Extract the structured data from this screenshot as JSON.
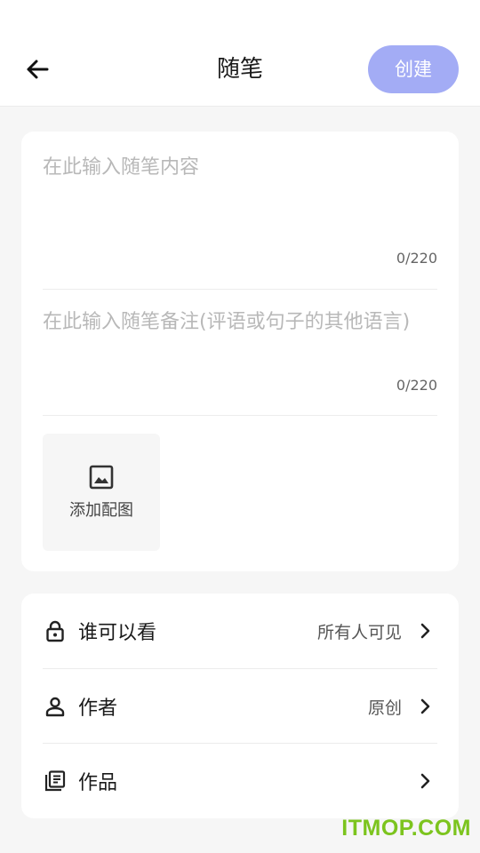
{
  "header": {
    "title": "随笔",
    "create_label": "创建",
    "back_icon": "arrow-left-icon",
    "accent_color": "#a3acf5"
  },
  "editor": {
    "content_placeholder": "在此输入随笔内容",
    "content_counter": "0/220",
    "remark_placeholder": "在此输入随笔备注(评语或句子的其他语言)",
    "remark_counter": "0/220",
    "add_image_label": "添加配图",
    "add_image_icon": "image-icon"
  },
  "settings": {
    "rows": [
      {
        "icon": "lock-icon",
        "label": "谁可以看",
        "value": "所有人可见"
      },
      {
        "icon": "person-icon",
        "label": "作者",
        "value": "原创"
      },
      {
        "icon": "book-icon",
        "label": "作品",
        "value": ""
      }
    ]
  },
  "watermark": "ITMOP.COM"
}
